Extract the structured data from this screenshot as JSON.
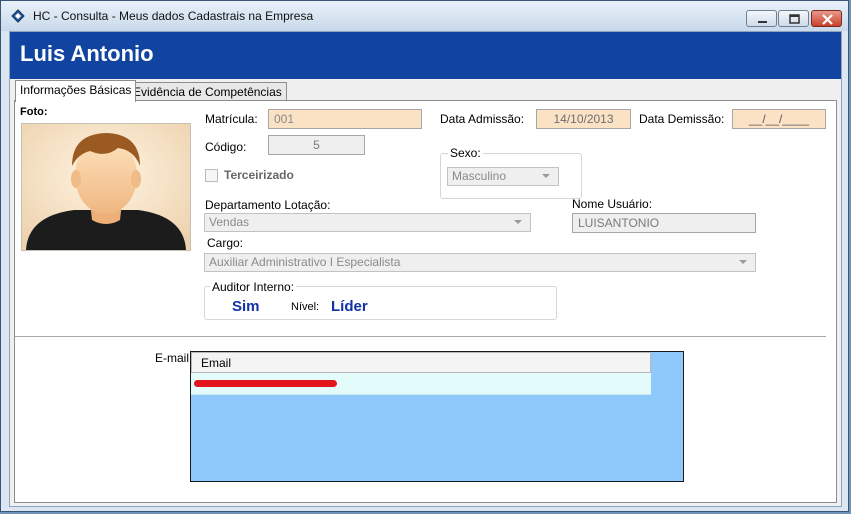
{
  "window": {
    "title": "HC - Consulta - Meus dados Cadastrais na Empresa",
    "icon": "app-diamond-icon",
    "controls": {
      "minimize": "minimize-icon",
      "maximize": "maximize-icon",
      "close": "close-icon"
    }
  },
  "header": {
    "name": "Luis Antonio",
    "background": "#1144a0"
  },
  "tabs": [
    {
      "label": "Informações Básicas",
      "active": true
    },
    {
      "label": "Evidência de Competências",
      "active": false
    }
  ],
  "form": {
    "photo_label": "Foto:",
    "matricula_label": "Matrícula:",
    "matricula_value": "001",
    "data_admissao_label": "Data Admissão:",
    "data_admissao_value": "14/10/2013",
    "data_demissao_label": "Data Demissão:",
    "data_demissao_value": "__/__/____",
    "codigo_label": "Código:",
    "codigo_value": "5",
    "sexo_label": "Sexo:",
    "sexo_value": "Masculino",
    "terceirizado_label": "Terceirizado",
    "terceirizado_checked": false,
    "departamento_label": "Departamento Lotação:",
    "departamento_value": "Vendas",
    "nome_usuario_label": "Nome Usuário:",
    "nome_usuario_value": "LUISANTONIO",
    "cargo_label": "Cargo:",
    "cargo_value": "Auxiliar Administrativo I Especialista",
    "auditor_label": "Auditor Interno:",
    "auditor_value": "Sim",
    "nivel_label": "Nível:",
    "nivel_value": "Líder",
    "accent_peach": "#fbe2c5",
    "accent_value_blue": "#1232a6"
  },
  "email": {
    "label": "E-mail",
    "column_header": "Email",
    "panel_color": "#8fc8fb"
  }
}
